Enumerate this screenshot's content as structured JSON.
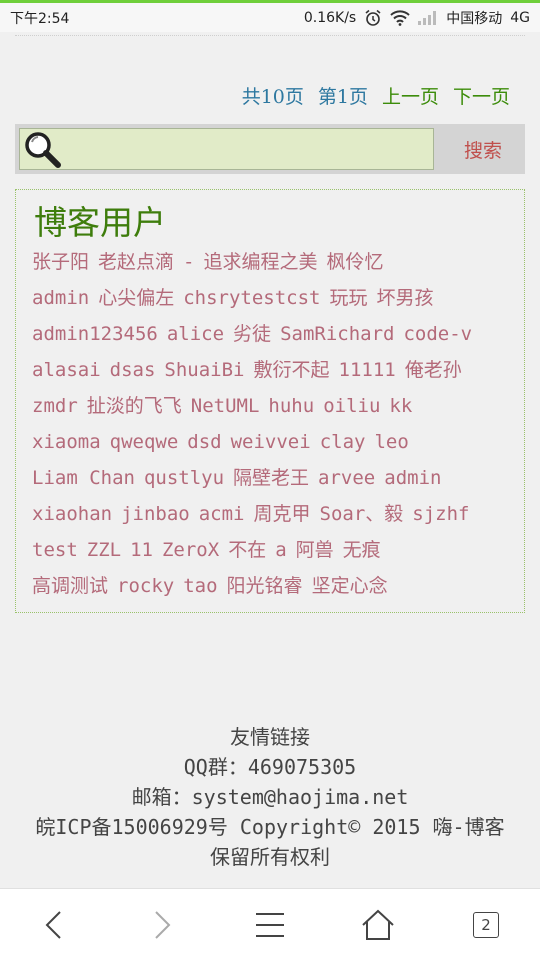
{
  "status_bar": {
    "time": "下午2:54",
    "net_speed": "0.16K/s",
    "carrier": "中国移动",
    "network": "4G"
  },
  "pager": {
    "total": "共10页",
    "current": "第1页",
    "prev": "上一页",
    "next": "下一页"
  },
  "search": {
    "value": "",
    "button": "搜索"
  },
  "blog_users": {
    "title": "博客用户",
    "lines": [
      [
        "张子阳",
        "老赵点滴",
        "-",
        "追求编程之美",
        "枫伶忆"
      ],
      [
        "admin",
        "心尖偏左",
        "chsrytestcst",
        "玩玩",
        "坏男孩"
      ],
      [
        "admin123456",
        "alice",
        "劣徒",
        "SamRichard",
        "code-v"
      ],
      [
        "alasai",
        "dsas",
        "ShuaiBi",
        "敷衍不起",
        "11111",
        "俺老孙"
      ],
      [
        "zmdr",
        "扯淡的飞飞",
        "NetUML",
        "huhu",
        "oiliu",
        "kk"
      ],
      [
        "xiaoma",
        "qweqwe",
        "dsd",
        "weivvei",
        "clay",
        "leo"
      ],
      [
        "Liam Chan",
        "qustlyu",
        "隔壁老王",
        "arvee",
        "admin"
      ],
      [
        "xiaohan",
        "jinbao",
        "acmi",
        "周克甲",
        "Soar、毅",
        "sjzhf"
      ],
      [
        "test",
        "ZZL",
        "11",
        "ZeroX",
        "不在",
        "a",
        "阿兽",
        "无痕"
      ],
      [
        "高调测试",
        "rocky",
        "tao",
        "阳光铭睿",
        "坚定心念"
      ]
    ]
  },
  "footer": {
    "links_title": "友情链接",
    "qq": "QQ群：469075305",
    "email": "邮箱：system@haojima.net",
    "icp": "皖ICP备15006929号 Copyright© 2015 嗨-博客",
    "rights": "保留所有权利"
  },
  "bottom_nav": {
    "tab_count": "2"
  }
}
